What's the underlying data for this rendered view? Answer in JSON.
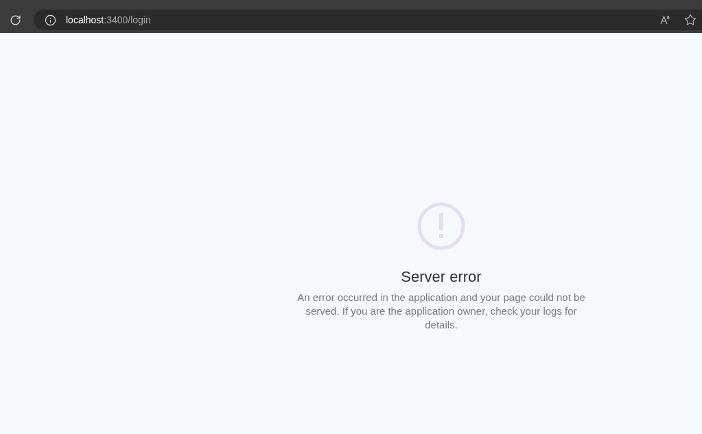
{
  "browser": {
    "url_host": "localhost",
    "url_path": ":3400/login"
  },
  "error": {
    "title": "Server error",
    "message": "An error occurred in the application and your page could not be served. If you are the application owner, check your logs for details."
  }
}
